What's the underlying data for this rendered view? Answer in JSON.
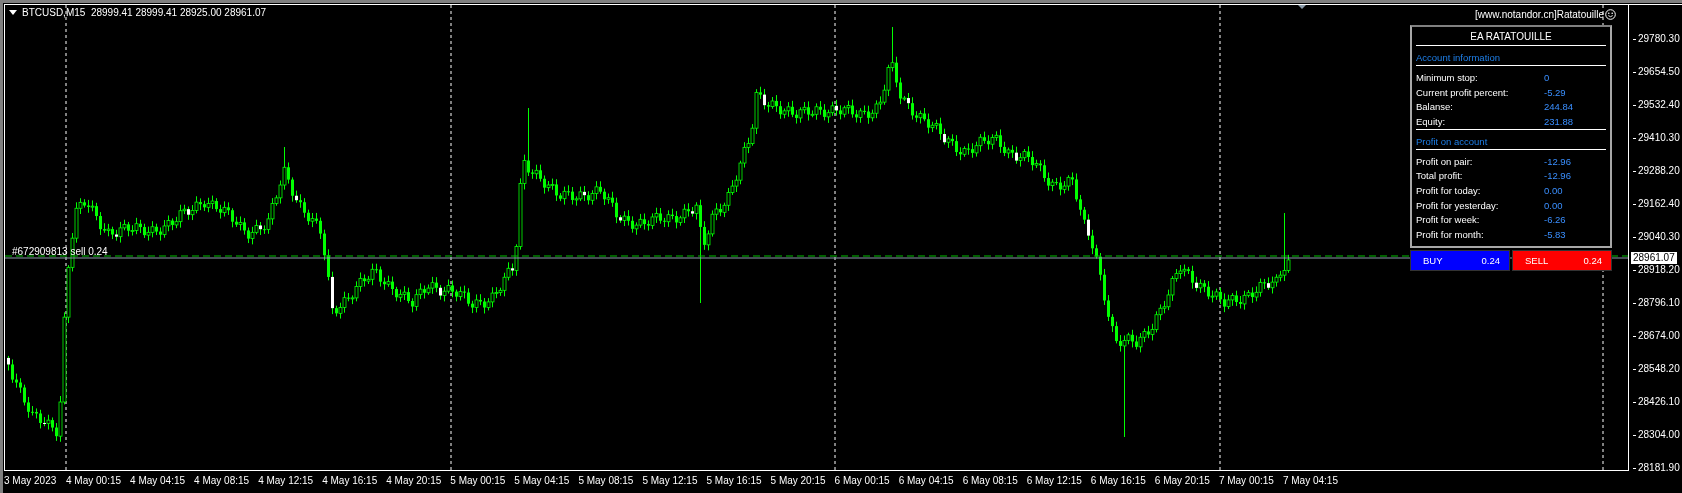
{
  "chart_header": {
    "symbol": "BTCUSD,M15",
    "ohlc": "28999.41 28999.41 28925.00 28961.07"
  },
  "chart_label": "[www.notandor.cn]Ratatouille",
  "order_line": {
    "label": "#672909813 sell 0.24"
  },
  "ea_panel": {
    "title": "EA RATATOUILLE",
    "sections": [
      {
        "heading": "Account information",
        "rows": [
          {
            "label": "Minimum stop:",
            "value": "0"
          },
          {
            "label": "Current profit percent:",
            "value": "-5.29"
          },
          {
            "label": "Balanse:",
            "value": "244.84"
          },
          {
            "label": "Equity:",
            "value": "231.88"
          }
        ]
      },
      {
        "heading": "Profit on account",
        "rows": [
          {
            "label": "Profit on pair:",
            "value": "-12.96"
          },
          {
            "label": "Total profit:",
            "value": "-12.96"
          },
          {
            "label": "Profit for today:",
            "value": "0.00"
          },
          {
            "label": "Profit for yesterday:",
            "value": "0.00"
          },
          {
            "label": "Profit for week:",
            "value": "-6.26"
          },
          {
            "label": "Profit for month:",
            "value": "-5.83"
          }
        ]
      }
    ],
    "buttons": [
      {
        "kind": "buy",
        "label": "BUY",
        "volume": "0.24"
      },
      {
        "kind": "sell",
        "label": "SELL",
        "volume": "0.24"
      }
    ]
  },
  "price_axis": {
    "ticks": [
      "29780.30",
      "29654.50",
      "29532.40",
      "29410.30",
      "29288.20",
      "29162.40",
      "29040.30",
      "28918.20",
      "28796.10",
      "28674.00",
      "28548.20",
      "28426.10",
      "28304.00",
      "28181.90"
    ],
    "current_price": "28961.07"
  },
  "time_axis": {
    "labels": [
      "3 May 2023",
      "4 May 00:15",
      "4 May 04:15",
      "4 May 08:15",
      "4 May 12:15",
      "4 May 16:15",
      "4 May 20:15",
      "5 May 00:15",
      "5 May 04:15",
      "5 May 08:15",
      "5 May 12:15",
      "5 May 16:15",
      "5 May 20:15",
      "6 May 00:15",
      "6 May 04:15",
      "6 May 08:15",
      "6 May 12:15",
      "6 May 16:15",
      "6 May 20:15",
      "7 May 00:15",
      "7 May 04:15"
    ]
  }
}
